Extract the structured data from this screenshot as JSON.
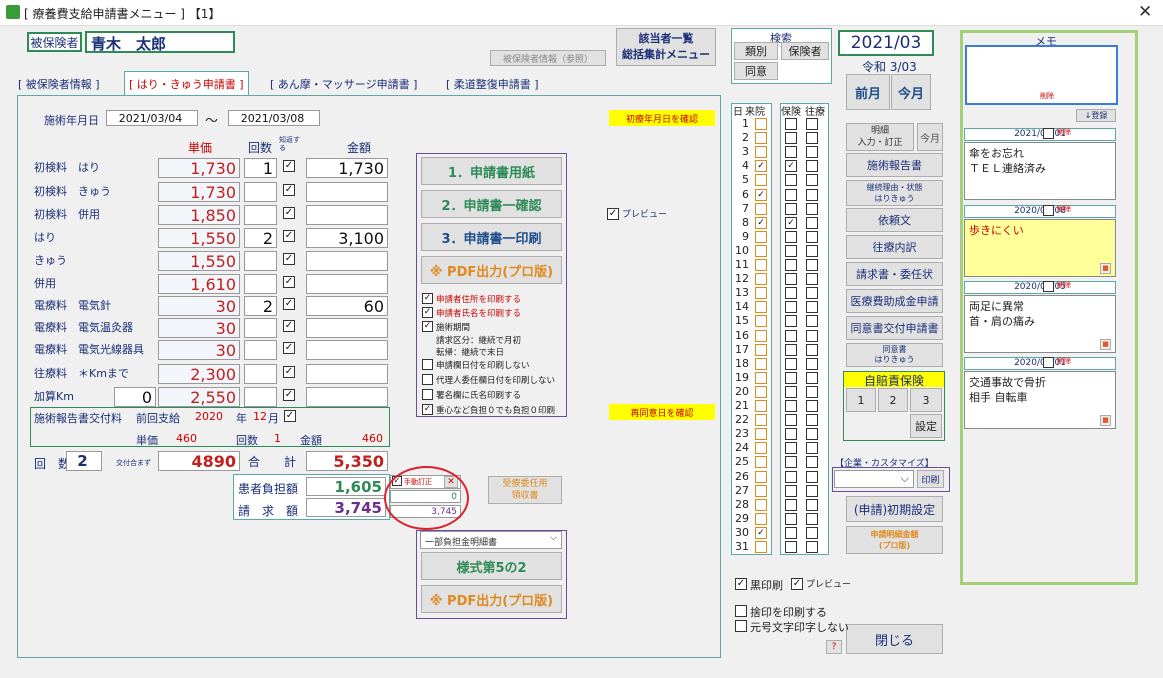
{
  "window": {
    "title": "[ 療養費支給申請書メニュー ] 【1】",
    "close_label": "✕"
  },
  "patient": {
    "label": "被保険者",
    "name": "青木　太郎",
    "ref_button": "被保険者情報（参照）"
  },
  "tabs": [
    "[ 被保険者情報 ]",
    "[ はり・きゅう申請書 ]",
    "[ あん摩・マッサージ申請書 ]",
    "[ 柔道整復申請書 ]"
  ],
  "top_buttons": {
    "list": "該当者一覧\n総括集計メニュー",
    "search_label": "検索",
    "search_cat": "類別",
    "search_ins": "保険者",
    "search_consent": "同意"
  },
  "date": {
    "period": "2021/03",
    "wareki": "令和 3/03",
    "prev": "前月",
    "cur": "今月"
  },
  "treatment": {
    "label": "施術年月日",
    "from": "2021/03/04",
    "tilde": "～",
    "to": "2021/03/08",
    "confirm_first": "初療年月日を確認",
    "confirm_reagree": "再同意日を確認"
  },
  "columns": {
    "unit": "単価",
    "count": "回数",
    "notify": "知返する",
    "amount": "金額"
  },
  "rows": [
    {
      "name": "初検料　はり",
      "unit": "1,730",
      "count": "1",
      "amount": "1,730"
    },
    {
      "name": "初検料　きゅう",
      "unit": "1,730",
      "count": "",
      "amount": ""
    },
    {
      "name": "初検料　併用",
      "unit": "1,850",
      "count": "",
      "amount": ""
    },
    {
      "name": "はり",
      "unit": "1,550",
      "count": "2",
      "amount": "3,100"
    },
    {
      "name": "きゅう",
      "unit": "1,550",
      "count": "",
      "amount": ""
    },
    {
      "name": "併用",
      "unit": "1,610",
      "count": "",
      "amount": ""
    },
    {
      "name": "電療料　電気針",
      "unit": "30",
      "count": "2",
      "amount": "60"
    },
    {
      "name": "電療料　電気温灸器",
      "unit": "30",
      "count": "",
      "amount": ""
    },
    {
      "name": "電療料　電気光線器具",
      "unit": "30",
      "count": "",
      "amount": ""
    },
    {
      "name": "往療料　＊Kmまで",
      "unit": "2,300",
      "count": "",
      "amount": ""
    },
    {
      "name": "加算Km",
      "unit": "2,550",
      "count": "",
      "amount": "",
      "km": "0"
    }
  ],
  "report": {
    "title": "施術報告書交付料",
    "prev": "前回支給",
    "year": "2020",
    "year_lbl": "年",
    "month": "12",
    "month_lbl": "月",
    "unit_lbl": "単価",
    "unit": "460",
    "count_lbl": "回数",
    "count": "1",
    "amount_lbl": "金額",
    "amount": "460"
  },
  "totals": {
    "times_lbl": "回　数",
    "times": "2",
    "until_lbl": "交付合まず",
    "until": "4890",
    "sum_lbl": "合　　計",
    "sum": "5,350",
    "patient_lbl": "患者負担額",
    "patient": "1,605",
    "bill_lbl": "請　求　額",
    "bill": "3,745",
    "manual": "手動訂正",
    "manual_val": "0",
    "manual_bill": "3,745",
    "close_x": "✕"
  },
  "print": {
    "b1": "1．申請書用紙",
    "b2": "2．申請書一確認",
    "b3": "3．申請書一印刷",
    "b4": "※ PDF出力(プロ版)",
    "preview": "プレビュー"
  },
  "options": [
    "申請者住所を印刷する",
    "申請者氏名を印刷する",
    "施術期間",
    "請求区分：継続で月初",
    "転帰：継続で末日",
    "申請欄日付を印刷しない",
    "代理人委任欄日付を印刷しない",
    "署名欄に氏名印刷する",
    "重心など負担０でも負担０印刷"
  ],
  "bottom": {
    "select": "一部負担金明細書",
    "style": "様式第5の2",
    "pdf": "※ PDF出力(プロ版)",
    "consent": "受療委任用\n領収書"
  },
  "grid": {
    "day": "日",
    "visit": "来院",
    "ins": "保険",
    "house": "往療",
    "days": [
      "1",
      "2",
      "3",
      "4",
      "5",
      "6",
      "7",
      "8",
      "9",
      "10",
      "11",
      "12",
      "13",
      "14",
      "15",
      "16",
      "17",
      "18",
      "19",
      "20",
      "21",
      "22",
      "23",
      "24",
      "25",
      "26",
      "27",
      "28",
      "29",
      "30",
      "31"
    ],
    "visits": [
      4,
      6,
      8,
      30
    ],
    "ins_checked": [
      4,
      8
    ]
  },
  "side": {
    "detail": "明細\n入力・訂正",
    "cur": "今月",
    "report": "施術報告書",
    "reason": "継続理由・状態\nはりきゅう",
    "request": "依頼文",
    "round": "往療内訳",
    "bill": "請求書・委任状",
    "aid": "医療費助成金申請",
    "consent": "同意書交付申請書",
    "consent2": "同意書\nはりきゅう",
    "jibai": "自賠責保険",
    "j1": "1",
    "j2": "2",
    "j3": "3",
    "set": "設定",
    "custom": "【企業・カスタマイズ】",
    "print": "印刷",
    "init": "(申請)初期設定",
    "detail_amt": "申請明細金額\n(プロ版)",
    "close": "閉じる",
    "help": "?"
  },
  "footer": {
    "black": "黒印刷",
    "preview": "プレビュー",
    "stamp": "捨印を印刷する",
    "era": "元号文字印字しない"
  },
  "memo": {
    "title": "メモ",
    "delete": "削除",
    "register": "↓登録",
    "entries": [
      {
        "date": "2021/04/01",
        "text": "傘をお忘れ\nＴＥＬ連絡済み"
      },
      {
        "date": "2020/06/08",
        "text": "歩きにくい"
      },
      {
        "date": "2020/06/05",
        "text": "両足に異常\n首・肩の痛み"
      },
      {
        "date": "2020/06/01",
        "text": "交通事故で骨折\n相手 自転車"
      }
    ]
  }
}
